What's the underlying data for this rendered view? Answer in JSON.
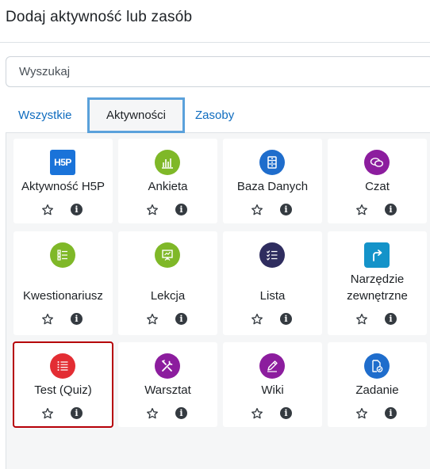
{
  "modal": {
    "title": "Dodaj aktywność lub zasób"
  },
  "search": {
    "placeholder": "Wyszukaj"
  },
  "tabs": [
    {
      "label": "Wszystkie"
    },
    {
      "label": "Aktywności"
    },
    {
      "label": "Zasoby"
    }
  ],
  "activities": [
    {
      "label": "Aktywność H5P",
      "icon": "h5p-icon",
      "color": "#1a73d9"
    },
    {
      "label": "Ankieta",
      "icon": "bar-chart-icon",
      "color": "#7fb828"
    },
    {
      "label": "Baza Danych",
      "icon": "database-icon",
      "color": "#1f6dcc"
    },
    {
      "label": "Czat",
      "icon": "chat-bubbles-icon",
      "color": "#8c1d9e"
    },
    {
      "label": "Kwestionariusz",
      "icon": "checklist-icon",
      "color": "#7fb828"
    },
    {
      "label": "Lekcja",
      "icon": "presentation-board-icon",
      "color": "#7fb828"
    },
    {
      "label": "Lista",
      "icon": "checklist-icon",
      "color": "#2f2d5f"
    },
    {
      "label": "Narzędzie zewnętrzne",
      "icon": "external-link-arrow-icon",
      "color": "#1493c9"
    },
    {
      "label": "Test (Quiz)",
      "icon": "quiz-list-icon",
      "color": "#e32d33"
    },
    {
      "label": "Warsztat",
      "icon": "tools-icon",
      "color": "#8c1d9e"
    },
    {
      "label": "Wiki",
      "icon": "pencil-icon",
      "color": "#8c1d9e"
    },
    {
      "label": "Zadanie",
      "icon": "assignment-check-icon",
      "color": "#1f6dcc"
    }
  ],
  "action_icons": {
    "star": "star-outline-icon",
    "info": "info-icon",
    "info_glyph": "i"
  }
}
